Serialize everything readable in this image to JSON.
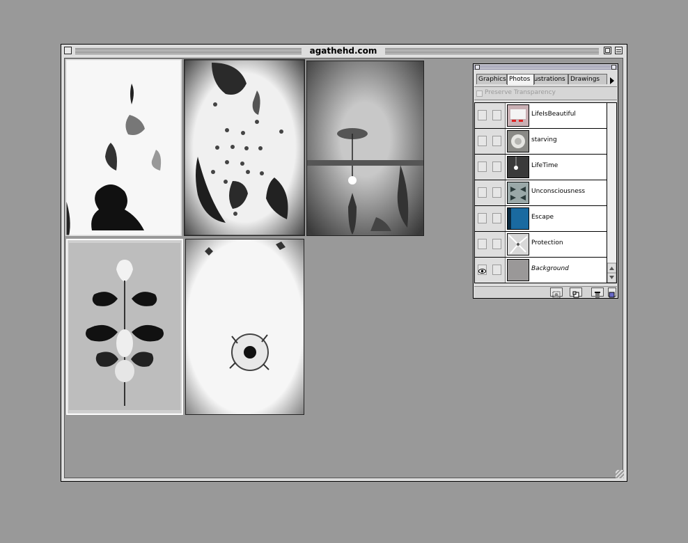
{
  "window": {
    "title": "agathehd.com"
  },
  "photos": [
    {
      "subject": "leaves and figure silhouette"
    },
    {
      "subject": "leaves and small flowers"
    },
    {
      "subject": "ceiling light bulb"
    },
    {
      "subject": "symmetric inkblot flowers"
    },
    {
      "subject": "single flower"
    }
  ],
  "palette": {
    "tabs": [
      "Graphics",
      "Photos",
      "Illustrations",
      "Drawings"
    ],
    "active_tab": "Photos",
    "preserve_transparency": "Preserve Transparency",
    "layers": [
      {
        "name": "LifeIsBeautiful",
        "visible": false,
        "thumb_color": "#c9b0b4"
      },
      {
        "name": "starving",
        "visible": false,
        "thumb_color": "#8a8a86"
      },
      {
        "name": "LifeTime",
        "visible": false,
        "thumb_color": "#3a3a3a"
      },
      {
        "name": "Unconsciousness",
        "visible": false,
        "thumb_color": "#9aa8a8"
      },
      {
        "name": "Escape",
        "visible": false,
        "thumb_color": "#1a6aa0"
      },
      {
        "name": "Protection",
        "visible": false,
        "thumb_color": "#d8d8d8"
      },
      {
        "name": "Background",
        "visible": true,
        "thumb_color": "#9a9898"
      }
    ]
  },
  "colors": {
    "desktop": "#999999",
    "chrome": "#dedede"
  }
}
